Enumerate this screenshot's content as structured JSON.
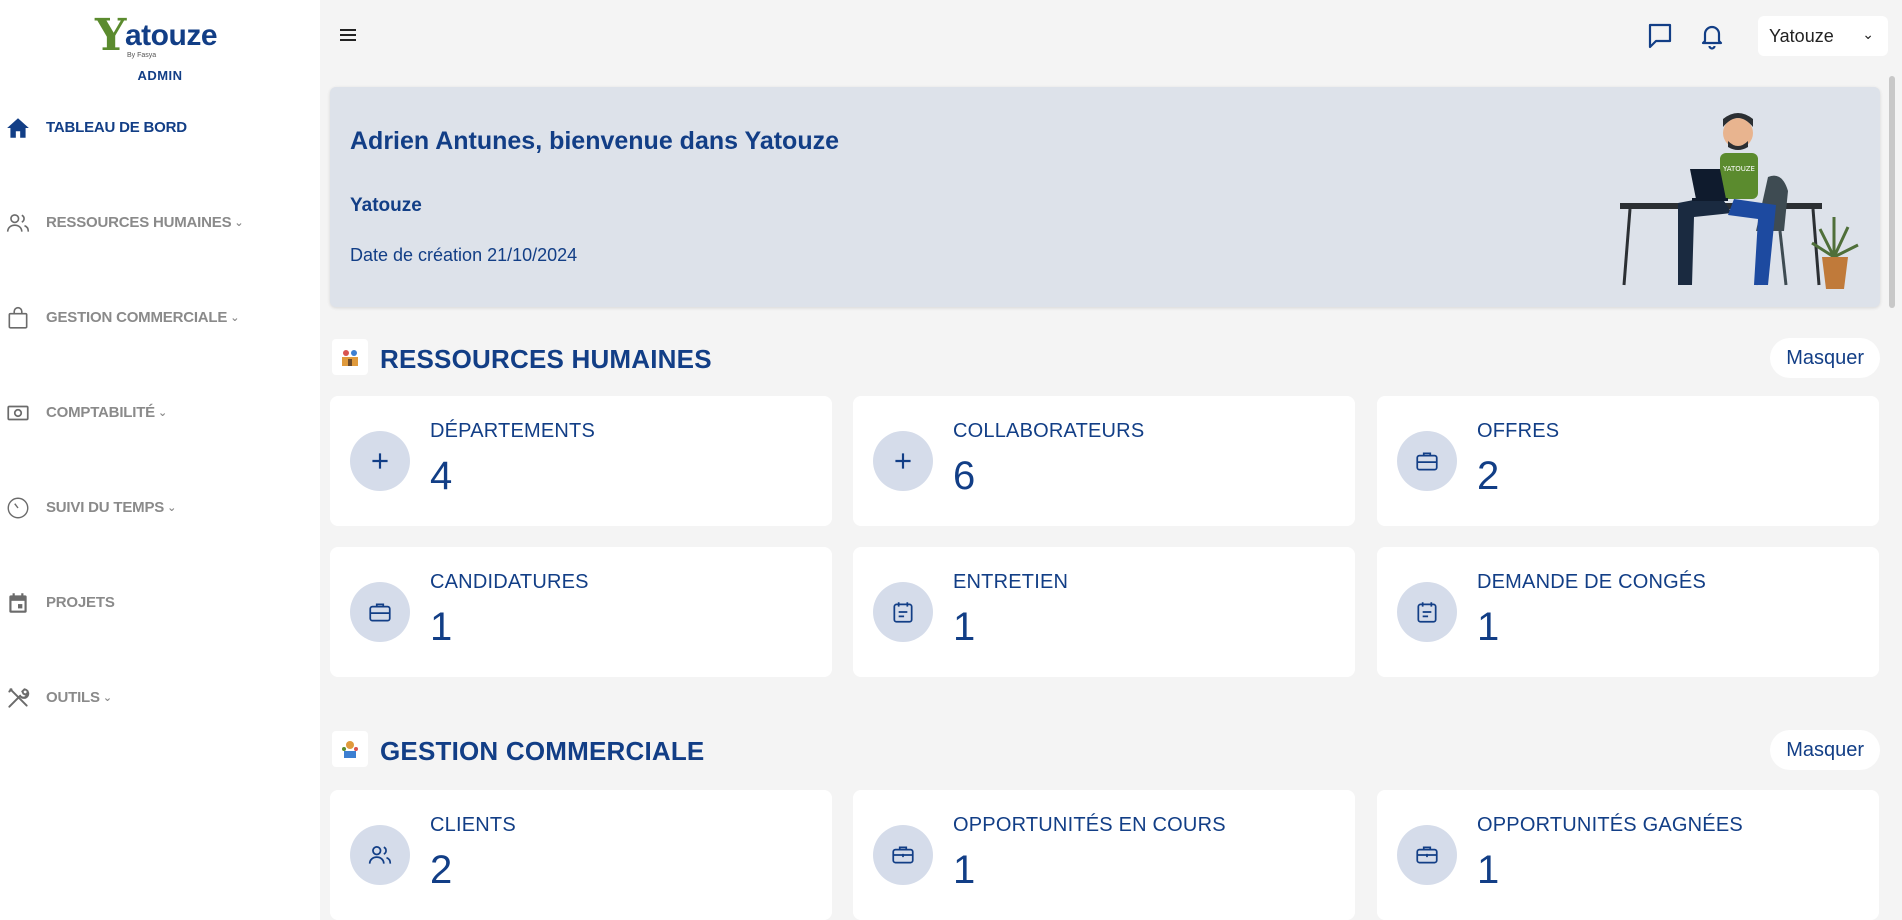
{
  "brand": {
    "logo_y": "Y",
    "logo_rest": "atouze",
    "logo_by": "By Fasya",
    "role": "ADMIN"
  },
  "sidebar": {
    "items": [
      {
        "label": "TABLEAU DE BORD",
        "icon": "home-icon",
        "active": true,
        "has_caret": false
      },
      {
        "label": "RESSOURCES HUMAINES",
        "icon": "users-icon",
        "active": false,
        "has_caret": true
      },
      {
        "label": "GESTION COMMERCIALE",
        "icon": "shopping-bag-icon",
        "active": false,
        "has_caret": true
      },
      {
        "label": "COMPTABILITÉ",
        "icon": "cash-icon",
        "active": false,
        "has_caret": true
      },
      {
        "label": "SUIVI DU TEMPS",
        "icon": "clock-icon",
        "active": false,
        "has_caret": true
      },
      {
        "label": "PROJETS",
        "icon": "calendar-icon",
        "active": false,
        "has_caret": false
      },
      {
        "label": "OUTILS",
        "icon": "tools-icon",
        "active": false,
        "has_caret": true
      }
    ]
  },
  "topbar": {
    "company_select": "Yatouze",
    "chat_icon": "message-icon",
    "notif_icon": "bell-icon"
  },
  "banner": {
    "welcome": "Adrien Antunes, bienvenue dans Yatouze",
    "company": "Yatouze",
    "creation": "Date de création 21/10/2024"
  },
  "sections": {
    "rh": {
      "title": "RESSOURCES HUMAINES",
      "toggle": "Masquer",
      "cards": [
        {
          "label": "DÉPARTEMENTS",
          "value": "4",
          "icon": "plus-icon"
        },
        {
          "label": "COLLABORATEURS",
          "value": "6",
          "icon": "plus-icon"
        },
        {
          "label": "OFFRES",
          "value": "2",
          "icon": "briefcase-icon"
        },
        {
          "label": "CANDIDATURES",
          "value": "1",
          "icon": "briefcase-icon"
        },
        {
          "label": "ENTRETIEN",
          "value": "1",
          "icon": "calendar-icon"
        },
        {
          "label": "DEMANDE DE CONGÉS",
          "value": "1",
          "icon": "calendar-icon"
        }
      ]
    },
    "gc": {
      "title": "GESTION COMMERCIALE",
      "toggle": "Masquer",
      "cards": [
        {
          "label": "CLIENTS",
          "value": "2",
          "icon": "users-icon"
        },
        {
          "label": "OPPORTUNITÉS EN COURS",
          "value": "1",
          "icon": "briefcase-icon"
        },
        {
          "label": "OPPORTUNITÉS GAGNÉES",
          "value": "1",
          "icon": "briefcase-icon"
        }
      ]
    }
  },
  "colors": {
    "primary": "#123e86",
    "accent_green": "#5b8b2e",
    "banner_bg": "#dde2ea",
    "circle_bg": "#d5dcea"
  }
}
